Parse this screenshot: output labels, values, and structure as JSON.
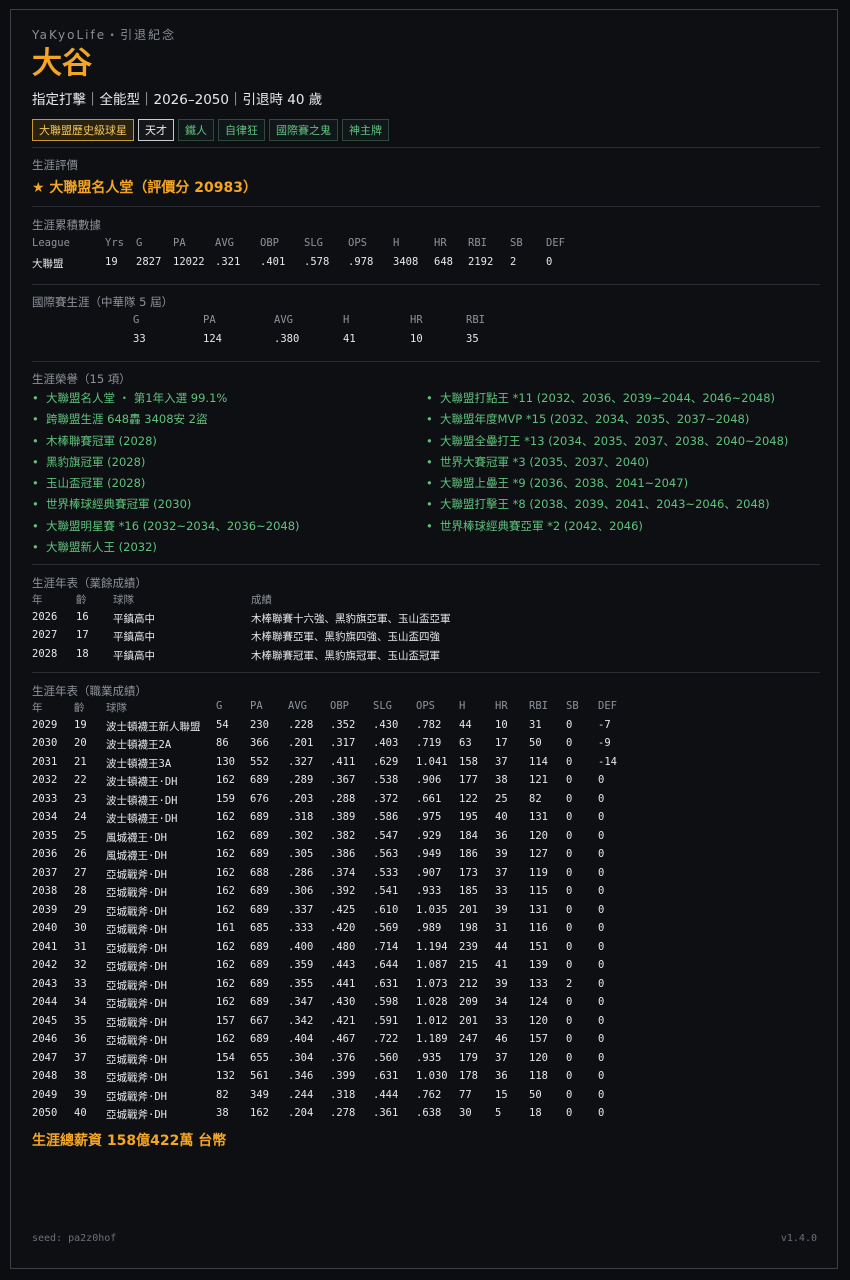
{
  "brand": "YaKyoLife・引退紀念",
  "player": {
    "name": "大谷",
    "meta": "指定打擊｜全能型｜2026–2050｜引退時 40 歲"
  },
  "tags": [
    {
      "label": "大聯盟歷史級球星",
      "style": "gold"
    },
    {
      "label": "天才",
      "style": "white"
    },
    {
      "label": "鐵人",
      "style": "green"
    },
    {
      "label": "自律狂",
      "style": "green"
    },
    {
      "label": "國際賽之鬼",
      "style": "green"
    },
    {
      "label": "神主牌",
      "style": "green"
    }
  ],
  "evaluation": {
    "label": "生涯評價",
    "value": "★ 大聯盟名人堂（評價分 20983）"
  },
  "career_totals": {
    "label": "生涯累積數據",
    "headers": [
      "League",
      "Yrs",
      "G",
      "PA",
      "AVG",
      "OBP",
      "SLG",
      "OPS",
      "H",
      "HR",
      "RBI",
      "SB",
      "DEF"
    ],
    "row": [
      "大聯盟",
      "19",
      "2827",
      "12022",
      ".321",
      ".401",
      ".578",
      ".978",
      "3408",
      "648",
      "2192",
      "2",
      "0"
    ]
  },
  "international": {
    "label": "國際賽生涯（中華隊 5 屆）",
    "headers": [
      "G",
      "PA",
      "AVG",
      "H",
      "HR",
      "RBI"
    ],
    "row": [
      "33",
      "124",
      ".380",
      "41",
      "10",
      "35"
    ]
  },
  "honors": {
    "label": "生涯榮譽（15 項）",
    "left": [
      "大聯盟名人堂 ・ 第1年入選 99.1%",
      "跨聯盟生涯 648轟 3408安 2盜",
      "木棒聯賽冠軍 (2028)",
      "黑豹旗冠軍 (2028)",
      "玉山盃冠軍 (2028)",
      "世界棒球經典賽冠軍 (2030)",
      "大聯盟明星賽 *16 (2032~2034、2036~2048)",
      "大聯盟新人王 (2032)"
    ],
    "right": [
      "大聯盟打點王 *11 (2032、2036、2039~2044、2046~2048)",
      "大聯盟年度MVP *15 (2032、2034、2035、2037~2048)",
      "大聯盟全壘打王 *13 (2034、2035、2037、2038、2040~2048)",
      "世界大賽冠軍 *3 (2035、2037、2040)",
      "大聯盟上壘王 *9 (2036、2038、2041~2047)",
      "大聯盟打擊王 *8 (2038、2039、2041、2043~2046、2048)",
      "世界棒球經典賽亞軍 *2 (2042、2046)"
    ]
  },
  "amateur": {
    "label": "生涯年表（業餘成績）",
    "headers": [
      "年",
      "齡",
      "球隊",
      "成績"
    ],
    "rows": [
      [
        "2026",
        "16",
        "平鎮高中",
        "木棒聯賽十六強、黑豹旗亞軍、玉山盃亞軍"
      ],
      [
        "2027",
        "17",
        "平鎮高中",
        "木棒聯賽亞軍、黑豹旗四強、玉山盃四強"
      ],
      [
        "2028",
        "18",
        "平鎮高中",
        "木棒聯賽冠軍、黑豹旗冠軍、玉山盃冠軍"
      ]
    ]
  },
  "pro": {
    "label": "生涯年表（職業成績）",
    "headers": [
      "年",
      "齡",
      "球隊",
      "G",
      "PA",
      "AVG",
      "OBP",
      "SLG",
      "OPS",
      "H",
      "HR",
      "RBI",
      "SB",
      "DEF"
    ],
    "rows": [
      [
        "2029",
        "19",
        "波士頓襪王新人聯盟",
        "54",
        "230",
        ".228",
        ".352",
        ".430",
        ".782",
        "44",
        "10",
        "31",
        "0",
        "-7"
      ],
      [
        "2030",
        "20",
        "波士頓襪王2A",
        "86",
        "366",
        ".201",
        ".317",
        ".403",
        ".719",
        "63",
        "17",
        "50",
        "0",
        "-9"
      ],
      [
        "2031",
        "21",
        "波士頓襪王3A",
        "130",
        "552",
        ".327",
        ".411",
        ".629",
        "1.041",
        "158",
        "37",
        "114",
        "0",
        "-14"
      ],
      [
        "2032",
        "22",
        "波士頓襪王·DH",
        "162",
        "689",
        ".289",
        ".367",
        ".538",
        ".906",
        "177",
        "38",
        "121",
        "0",
        "0"
      ],
      [
        "2033",
        "23",
        "波士頓襪王·DH",
        "159",
        "676",
        ".203",
        ".288",
        ".372",
        ".661",
        "122",
        "25",
        "82",
        "0",
        "0"
      ],
      [
        "2034",
        "24",
        "波士頓襪王·DH",
        "162",
        "689",
        ".318",
        ".389",
        ".586",
        ".975",
        "195",
        "40",
        "131",
        "0",
        "0"
      ],
      [
        "2035",
        "25",
        "風城襪王·DH",
        "162",
        "689",
        ".302",
        ".382",
        ".547",
        ".929",
        "184",
        "36",
        "120",
        "0",
        "0"
      ],
      [
        "2036",
        "26",
        "風城襪王·DH",
        "162",
        "689",
        ".305",
        ".386",
        ".563",
        ".949",
        "186",
        "39",
        "127",
        "0",
        "0"
      ],
      [
        "2037",
        "27",
        "亞城戰斧·DH",
        "162",
        "688",
        ".286",
        ".374",
        ".533",
        ".907",
        "173",
        "37",
        "119",
        "0",
        "0"
      ],
      [
        "2038",
        "28",
        "亞城戰斧·DH",
        "162",
        "689",
        ".306",
        ".392",
        ".541",
        ".933",
        "185",
        "33",
        "115",
        "0",
        "0"
      ],
      [
        "2039",
        "29",
        "亞城戰斧·DH",
        "162",
        "689",
        ".337",
        ".425",
        ".610",
        "1.035",
        "201",
        "39",
        "131",
        "0",
        "0"
      ],
      [
        "2040",
        "30",
        "亞城戰斧·DH",
        "161",
        "685",
        ".333",
        ".420",
        ".569",
        ".989",
        "198",
        "31",
        "116",
        "0",
        "0"
      ],
      [
        "2041",
        "31",
        "亞城戰斧·DH",
        "162",
        "689",
        ".400",
        ".480",
        ".714",
        "1.194",
        "239",
        "44",
        "151",
        "0",
        "0"
      ],
      [
        "2042",
        "32",
        "亞城戰斧·DH",
        "162",
        "689",
        ".359",
        ".443",
        ".644",
        "1.087",
        "215",
        "41",
        "139",
        "0",
        "0"
      ],
      [
        "2043",
        "33",
        "亞城戰斧·DH",
        "162",
        "689",
        ".355",
        ".441",
        ".631",
        "1.073",
        "212",
        "39",
        "133",
        "2",
        "0"
      ],
      [
        "2044",
        "34",
        "亞城戰斧·DH",
        "162",
        "689",
        ".347",
        ".430",
        ".598",
        "1.028",
        "209",
        "34",
        "124",
        "0",
        "0"
      ],
      [
        "2045",
        "35",
        "亞城戰斧·DH",
        "157",
        "667",
        ".342",
        ".421",
        ".591",
        "1.012",
        "201",
        "33",
        "120",
        "0",
        "0"
      ],
      [
        "2046",
        "36",
        "亞城戰斧·DH",
        "162",
        "689",
        ".404",
        ".467",
        ".722",
        "1.189",
        "247",
        "46",
        "157",
        "0",
        "0"
      ],
      [
        "2047",
        "37",
        "亞城戰斧·DH",
        "154",
        "655",
        ".304",
        ".376",
        ".560",
        ".935",
        "179",
        "37",
        "120",
        "0",
        "0"
      ],
      [
        "2048",
        "38",
        "亞城戰斧·DH",
        "132",
        "561",
        ".346",
        ".399",
        ".631",
        "1.030",
        "178",
        "36",
        "118",
        "0",
        "0"
      ],
      [
        "2049",
        "39",
        "亞城戰斧·DH",
        "82",
        "349",
        ".244",
        ".318",
        ".444",
        ".762",
        "77",
        "15",
        "50",
        "0",
        "0"
      ],
      [
        "2050",
        "40",
        "亞城戰斧·DH",
        "38",
        "162",
        ".204",
        ".278",
        ".361",
        ".638",
        "30",
        "5",
        "18",
        "0",
        "0"
      ]
    ]
  },
  "salary": "生涯總薪資 158億422萬 台幣",
  "footer": {
    "seed": "seed: pa2z0hof",
    "version": "v1.4.0"
  }
}
